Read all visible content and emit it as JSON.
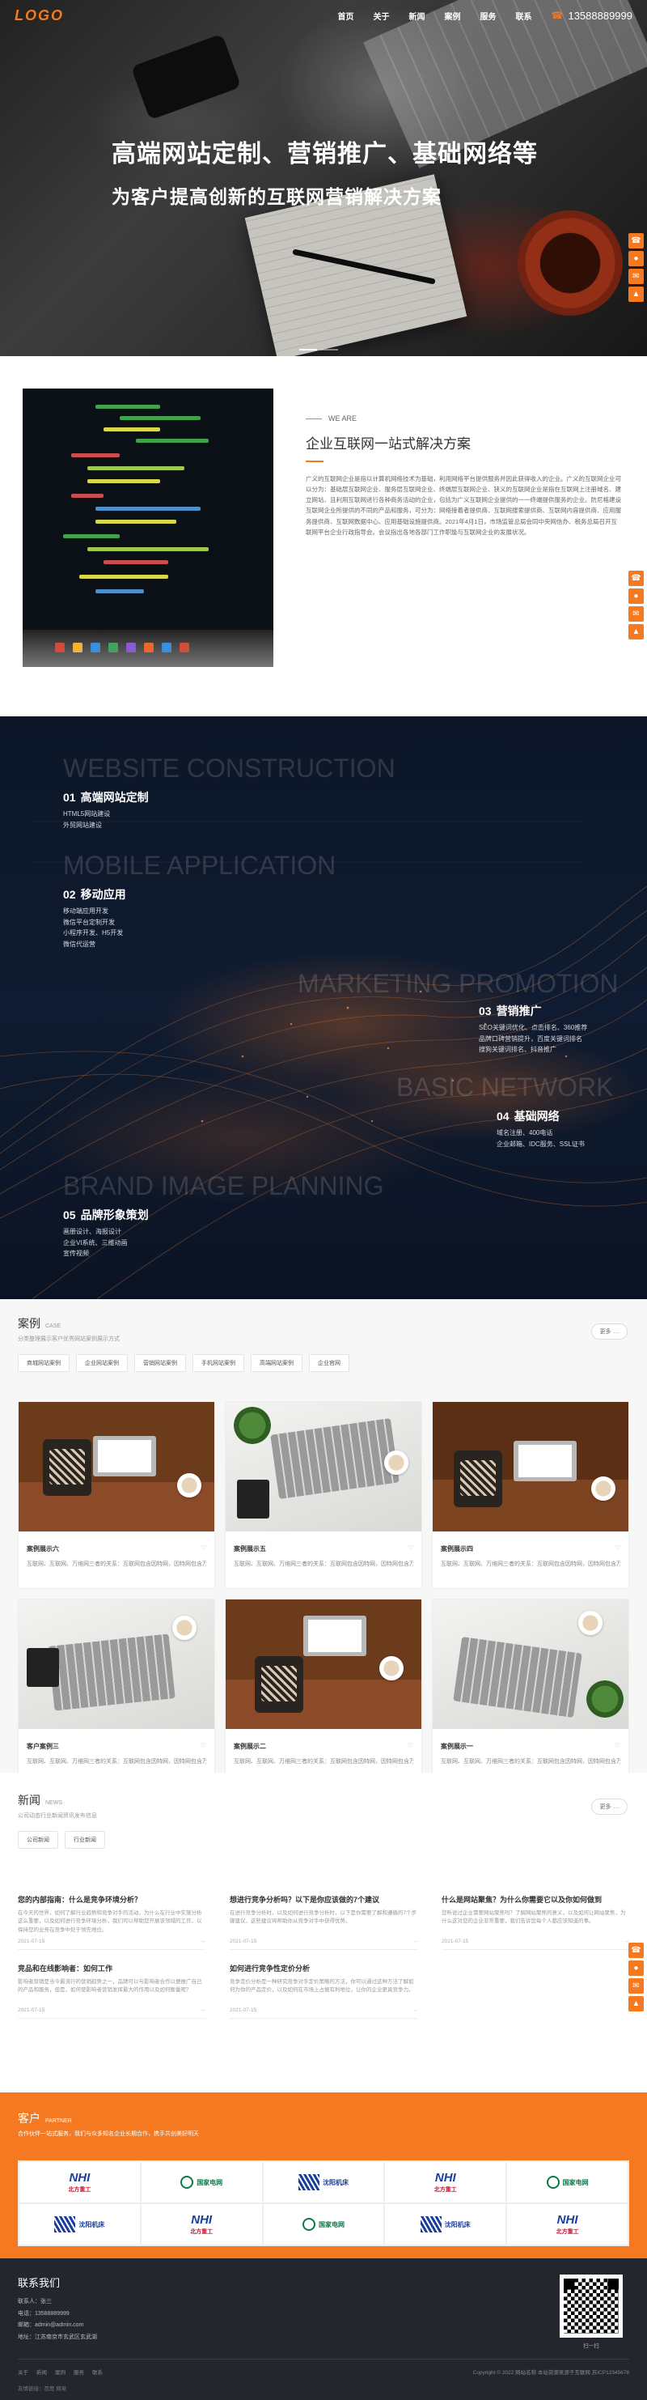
{
  "header": {
    "logo": "LOGO",
    "nav": [
      "首页",
      "关于",
      "新闻",
      "案例",
      "服务",
      "联系"
    ],
    "hotline": "13588889999"
  },
  "hero": {
    "title": "高端网站定制、营销推广、基础网络等",
    "subtitle": "为客户提高创新的互联网营销解决方案"
  },
  "side_tools": [
    "phone-icon",
    "wechat-icon",
    "mail-icon",
    "top-icon"
  ],
  "about": {
    "eyebrow": "WE ARE",
    "title": "企业互联网一站式解决方案",
    "body": "广义的互联网企业是指以计算机网络技术为基础，利用网络平台提供服务并因此获得收入的企业。广义的互联网企业可以分为：基础层互联网企业、服务层互联网企业、终端层互联网企业、狭义的互联网企业是指在互联网上注册域名、建立网站、且利用互联网进行各种商务活动的企业，包括为广义互联网企业提供的一一终端提供服务的企业。防尼格建设互联网企业所提供的不同的产品和服务，可分为：网络接着者提供商、互联网搜索提供商、互联网内容提供商、应用服务提供商、互联网数据中心、应用基础设施提供商。2021年4月1日，市场监管总局会同中央网信办、税务总局召开互联网平台企业行政指导会。会议指出各地各部门工作职能与互联网企业的发展状况。"
  },
  "services": [
    {
      "en": "WEBSITE CONSTRUCTION",
      "num": "01",
      "title": "高端网站定制",
      "items": [
        "HTML5网站建设",
        "外贸网站建设"
      ]
    },
    {
      "en": "MOBILE APPLICATION",
      "num": "02",
      "title": "移动应用",
      "items": [
        "移动端应用开发",
        "微信平台定制开发",
        "小程序开发、H5开发",
        "微信代运营"
      ]
    },
    {
      "en": "MARKETING PROMOTION",
      "num": "03",
      "title": "营销推广",
      "items": [
        "SEO关键词优化、点击排名、360推荐",
        "品牌口碑营销提升，百度关键词排名",
        "搜狗关键词排名、抖音推广"
      ]
    },
    {
      "en": "BASIC NETWORK",
      "num": "04",
      "title": "基础网络",
      "items": [
        "域名注册、400电话",
        "企业邮箱、IDC服务、SSL证书"
      ]
    },
    {
      "en": "BRAND IMAGE PLANNING",
      "num": "05",
      "title": "品牌形象策划",
      "items": [
        "画册设计、海报设计",
        "企业VI系统、三维动画",
        "宣传视频"
      ]
    }
  ],
  "cases": {
    "title": "案例",
    "title_en": "CASE",
    "subtitle": "分类整理展示客户优秀网站案例展示方式",
    "more": "更多",
    "filters": [
      "商城网站案例",
      "企业网站案例",
      "营销网站案例",
      "手机网站案例",
      "高端网站案例",
      "企业官网"
    ],
    "items": [
      {
        "name": "案例展示六",
        "desc": "互联网、互联网、万维网三者的关系：互联网包含因特网，因特网包含万维网"
      },
      {
        "name": "案例展示五",
        "desc": "互联网、互联网、万维网三者的关系：互联网包含因特网，因特网包含万维网"
      },
      {
        "name": "案例展示四",
        "desc": "互联网、互联网、万维网三者的关系：互联网包含因特网，因特网包含万维网"
      },
      {
        "name": "客户案例三",
        "desc": "互联网、互联网、万维网三者的关系：互联网包含因特网，因特网包含万维网"
      },
      {
        "name": "案例展示二",
        "desc": "互联网、互联网、万维网三者的关系：互联网包含因特网，因特网包含万维网"
      },
      {
        "name": "案例展示一",
        "desc": "互联网、互联网、万维网三者的关系：互联网包含因特网，因特网包含万维网"
      }
    ]
  },
  "news": {
    "title": "新闻",
    "title_en": "NEWS",
    "subtitle": "公司动态行业新闻资讯发布信息",
    "more": "更多",
    "tabs": [
      "公司新闻",
      "行业新闻"
    ],
    "items": [
      {
        "title": "您的内部指南：什么是竞争环境分析？",
        "desc": "在今天的世界，如何了解行业趋势和竞争对手的活动，为什么在行业中实施分析这么重要，以及如何进行竞争环境分析，我们可以帮助您开展该领域的工作，以保持您的业务在竞争中处于领先地位。",
        "date": "2021-07-15"
      },
      {
        "title": "想进行竞争分析吗？以下是你应该做的7个建议",
        "desc": "在进行竞争分析时，以及如何进行竞争分析时，以下是你需要了解和遵循的7个步骤建议，这些建议将帮助你从竞争对手中获得优势。",
        "date": "2021-07-15"
      },
      {
        "title": "什么是网站聚焦？为什么你需要它以及你如何做到",
        "desc": "您听说过企业需要网站聚焦吗？了解网站聚焦的意义，以及如何让网站聚焦，为什么这对您的企业非常重要，我们告诉您每个人都应该知道的事。",
        "date": "2021-07-15"
      },
      {
        "title": "竞品和在线影响者：如何工作",
        "desc": "影响者营销是当今最流行的营销趋势之一，品牌可以与影响者合作以便推广自己的产品和服务，但是，如何使影响者营销发挥最大的作用以及如何衡量呢？",
        "date": "2021-07-15"
      },
      {
        "title": "如何进行竞争性定价分析",
        "desc": "竞争定价分析是一种研究竞争对手定价策略的方法，你可以通过这种方法了解如何为你的产品定价，以及如何在市场上占据有利地位，让你的企业更具竞争力。",
        "date": "2021-07-15"
      }
    ]
  },
  "clients": {
    "title": "客户",
    "title_en": "PARTNER",
    "subtitle": "合作伙伴一站式服务，我们与众多知名企业长期合作，携手共创美好明天",
    "logos": [
      {
        "type": "nhi",
        "text": "NHI",
        "sub": "北方重工"
      },
      {
        "type": "grid",
        "text": "国家电网"
      },
      {
        "type": "sy",
        "text": "沈阳机床"
      },
      {
        "type": "nhi",
        "text": "NHI",
        "sub": "北方重工"
      },
      {
        "type": "grid",
        "text": "国家电网"
      },
      {
        "type": "sy",
        "text": "沈阳机床"
      },
      {
        "type": "nhi",
        "text": "NHI",
        "sub": "北方重工"
      },
      {
        "type": "grid",
        "text": "国家电网"
      },
      {
        "type": "sy",
        "text": "沈阳机床"
      },
      {
        "type": "nhi",
        "text": "NHI",
        "sub": "北方重工"
      }
    ]
  },
  "footer": {
    "title": "联系我们",
    "contact": [
      "联系人：张三",
      "电话：13588889999",
      "邮箱：admin@admin.com",
      "地址：江苏南京市玄武区玄武湖"
    ],
    "qr_caption": "扫一扫",
    "links": [
      "关于",
      "新闻",
      "案例",
      "服务",
      "联系"
    ],
    "copyright": "Copyright © 2022 网站名称 本站资源来源于互联网  苏ICP12345678",
    "tags": "友情链接：百度  网易"
  },
  "colors": {
    "accent": "#f47920",
    "navy": "#0f1b30",
    "footer": "#23262d"
  }
}
